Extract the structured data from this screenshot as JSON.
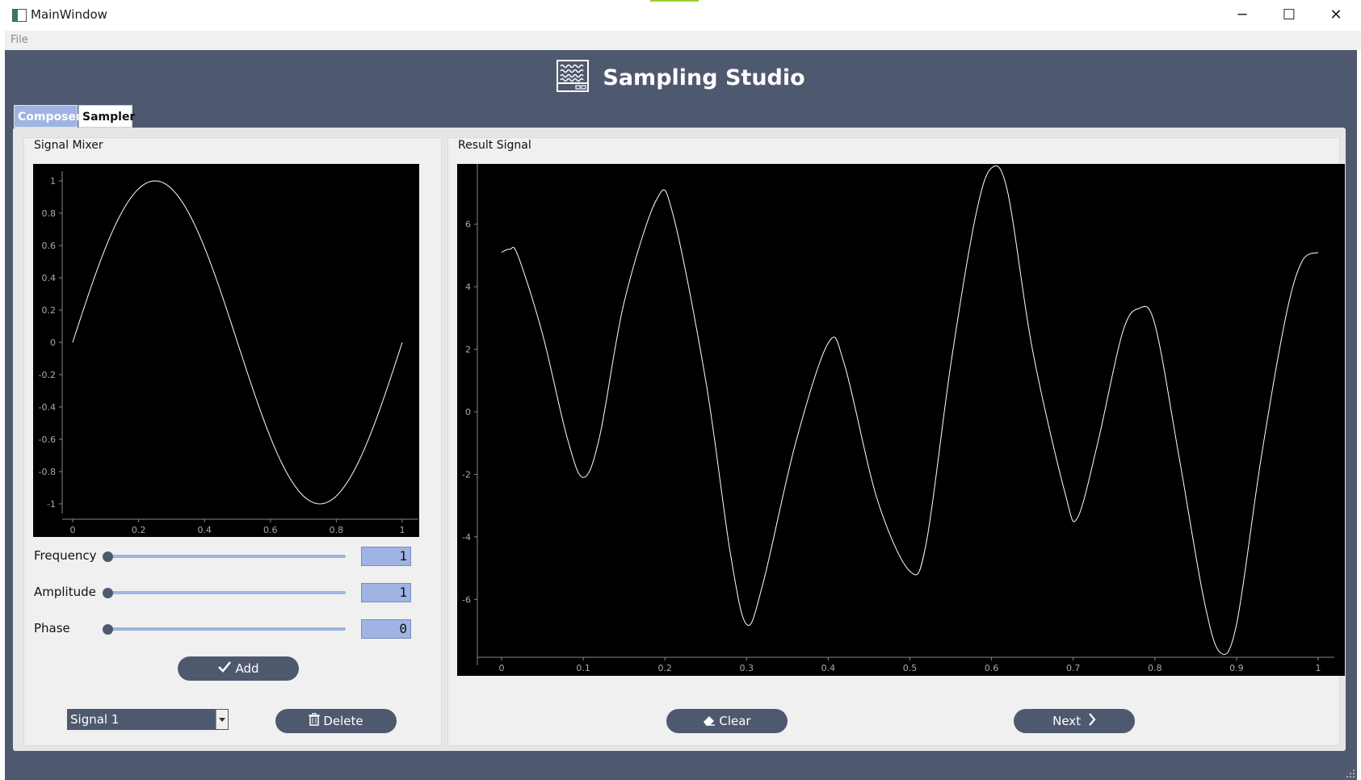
{
  "window": {
    "title": "MainWindow",
    "min_symbol": "─",
    "max_symbol": "☐",
    "close_symbol": "✕"
  },
  "menu": {
    "file_label": "File"
  },
  "header": {
    "title": "Sampling Studio",
    "icon": "waveform-monitor-icon"
  },
  "tabs": [
    {
      "label": "Composer",
      "active": true
    },
    {
      "label": "Sampler",
      "active": false
    }
  ],
  "mixer": {
    "title": "Signal Mixer",
    "frequency_label": "Frequency",
    "amplitude_label": "Amplitude",
    "phase_label": "Phase",
    "frequency_value": "1",
    "amplitude_value": "1",
    "phase_value": "0",
    "frequency_level": 0,
    "amplitude_level": 0,
    "phase_level": 0,
    "add_label": "Add",
    "signal_select": "Signal 1",
    "delete_label": "Delete"
  },
  "result": {
    "title": "Result Signal",
    "clear_label": "Clear",
    "next_label": "Next"
  },
  "colors": {
    "background": "#4e596f",
    "accent": "#9fb4e2",
    "plot_bg": "#000000",
    "trace": "#ffffff"
  },
  "chart_data": [
    {
      "type": "line",
      "title": "",
      "x_ticks": [
        "0",
        "0.2",
        "0.4",
        "0.6",
        "0.8",
        "1"
      ],
      "y_ticks": [
        "1",
        "0.8",
        "0.6",
        "0.4",
        "0.2",
        "0",
        "-0.2",
        "-0.4",
        "-0.6",
        "-0.8",
        "-1"
      ],
      "xlim": [
        0,
        1
      ],
      "ylim": [
        -1,
        1
      ],
      "series": [
        {
          "function": "sine",
          "frequency": 1,
          "amplitude": 1,
          "phase": 0
        }
      ]
    },
    {
      "type": "line",
      "title": "",
      "x_ticks": [
        "0",
        "0.1",
        "0.2",
        "0.3",
        "0.4",
        "0.5",
        "0.6",
        "0.7",
        "0.8",
        "0.9",
        "1"
      ],
      "y_ticks": [
        "6",
        "4",
        "2",
        "0",
        "-2",
        "-4",
        "-6"
      ],
      "xlim": [
        0,
        1
      ],
      "ylim": [
        -7.8,
        7.8
      ],
      "points": [
        [
          0,
          5.1
        ],
        [
          0.01,
          5.2
        ],
        [
          0.02,
          5.0
        ],
        [
          0.05,
          2.5
        ],
        [
          0.08,
          -0.8
        ],
        [
          0.1,
          -2.1
        ],
        [
          0.12,
          -0.8
        ],
        [
          0.15,
          3.5
        ],
        [
          0.19,
          6.8
        ],
        [
          0.21,
          6.3
        ],
        [
          0.25,
          1.0
        ],
        [
          0.28,
          -4.5
        ],
        [
          0.3,
          -6.8
        ],
        [
          0.32,
          -5.5
        ],
        [
          0.36,
          -1.0
        ],
        [
          0.4,
          2.2
        ],
        [
          0.42,
          1.5
        ],
        [
          0.46,
          -2.8
        ],
        [
          0.5,
          -5.1
        ],
        [
          0.52,
          -4.2
        ],
        [
          0.55,
          1.5
        ],
        [
          0.58,
          6.2
        ],
        [
          0.6,
          7.8
        ],
        [
          0.62,
          7.0
        ],
        [
          0.65,
          2.0
        ],
        [
          0.69,
          -2.6
        ],
        [
          0.705,
          -3.4
        ],
        [
          0.73,
          -1.0
        ],
        [
          0.76,
          2.5
        ],
        [
          0.78,
          3.3
        ],
        [
          0.8,
          2.8
        ],
        [
          0.83,
          -1.5
        ],
        [
          0.86,
          -6.0
        ],
        [
          0.88,
          -7.7
        ],
        [
          0.9,
          -6.8
        ],
        [
          0.93,
          -1.5
        ],
        [
          0.96,
          3.0
        ],
        [
          0.98,
          4.8
        ],
        [
          1,
          5.1
        ]
      ]
    }
  ]
}
